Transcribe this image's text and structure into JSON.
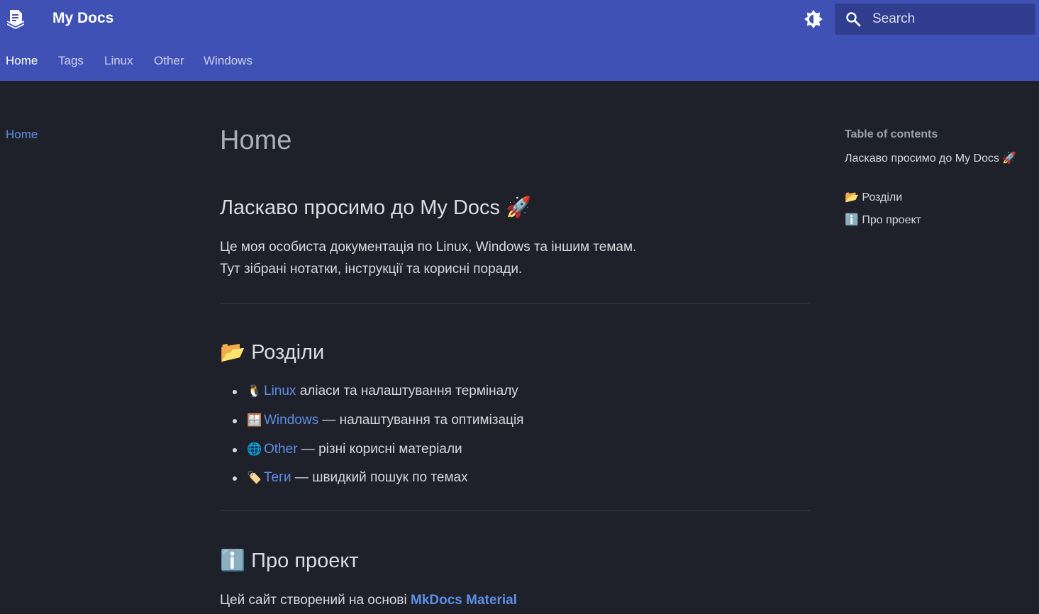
{
  "header": {
    "site_title": "My Docs",
    "logo_icon": "stacked-docs-icon",
    "palette_icon": "brightness-toggle-icon",
    "search": {
      "placeholder": "Search",
      "icon": "search-icon"
    }
  },
  "tabs": [
    {
      "label": "Home",
      "active": true
    },
    {
      "label": "Tags",
      "active": false
    },
    {
      "label": "Linux",
      "active": false
    },
    {
      "label": "Other",
      "active": false
    },
    {
      "label": "Windows",
      "active": false
    }
  ],
  "sidebar": {
    "items": [
      {
        "label": "Home",
        "active": true
      }
    ]
  },
  "content": {
    "title": "Home",
    "welcome": {
      "heading": "Ласкаво просимо до My Docs 🚀",
      "line1": "Це моя особиста документація по Linux, Windows та іншим темам.",
      "line2": "Тут зібрані нотатки, інструкції та корисні поради."
    },
    "sections": {
      "heading": "📂 Розділи",
      "items": [
        {
          "emoji": "🐧",
          "link": "Linux",
          "text": " аліаси та налаштування терміналу"
        },
        {
          "emoji": "🪟",
          "link": "Windows",
          "text": " — налаштування та оптимізація"
        },
        {
          "emoji": "🌐",
          "link": "Other",
          "text": " — різні корисні матеріали"
        },
        {
          "emoji": "🏷️",
          "link": "Теги",
          "text": " — швидкий пошук по темах"
        }
      ]
    },
    "about": {
      "heading": "ℹ️ Про проект",
      "text": "Цей сайт створений на основі ",
      "link": "MkDocs Material"
    }
  },
  "toc": {
    "title": "Table of contents",
    "items": [
      {
        "label": "Ласкаво просимо до My Docs 🚀"
      },
      {
        "label": "📂 Розділи"
      },
      {
        "label": "ℹ️ Про проект"
      }
    ]
  },
  "colors": {
    "header_bg": "#4051b5",
    "page_bg": "#1e2129",
    "link": "#5d8ee6"
  }
}
